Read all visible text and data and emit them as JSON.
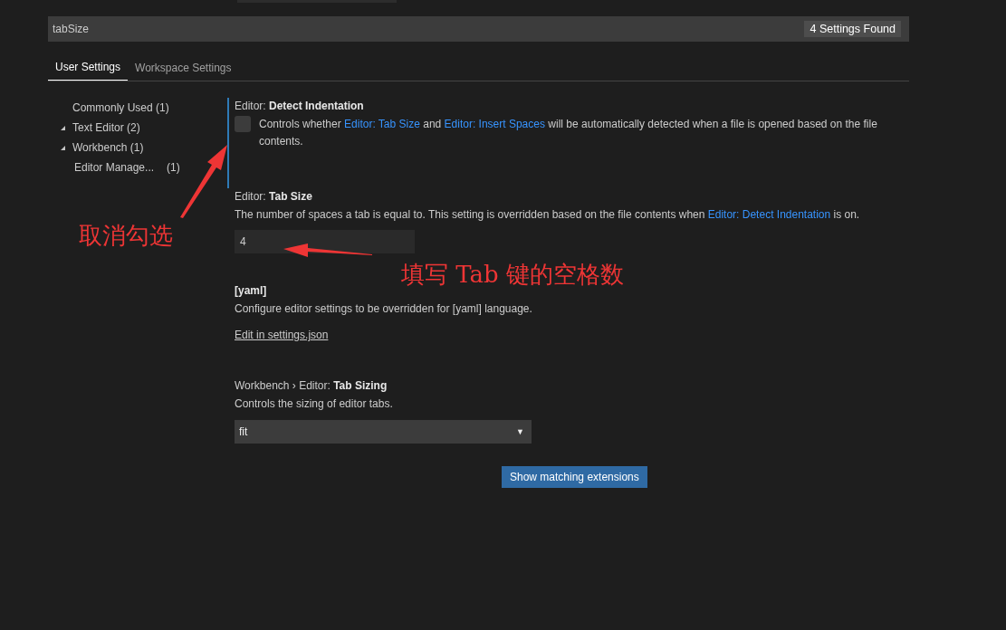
{
  "search": {
    "value": "tabSize",
    "count": "4 Settings Found"
  },
  "tabs": [
    {
      "label": "User Settings",
      "selected": true
    },
    {
      "label": "Workspace Settings",
      "selected": false
    }
  ],
  "sidebar": {
    "items": [
      {
        "kind": "leaf",
        "label": "Commonly Used",
        "count": "(1)"
      },
      {
        "kind": "group",
        "label": "Text Editor",
        "count": "(2)",
        "expanded": true
      },
      {
        "kind": "group",
        "label": "Workbench",
        "count": "(1)",
        "expanded": true,
        "children": [
          {
            "label": "Editor Manage...",
            "count": "(1)"
          }
        ]
      }
    ]
  },
  "settings": [
    {
      "kind": "checkbox",
      "focused": true,
      "prefix": "Editor:",
      "name": "Detect Indentation",
      "checked": false,
      "description": [
        {
          "kind": "text",
          "text": "Controls whether "
        },
        {
          "kind": "link",
          "text": "Editor: Tab Size"
        },
        {
          "kind": "text",
          "text": " and "
        },
        {
          "kind": "link",
          "text": "Editor: Insert Spaces"
        },
        {
          "kind": "text",
          "text": " will be automatically detected when a file is opened based on the file contents."
        }
      ]
    },
    {
      "kind": "number",
      "focused": false,
      "prefix": "Editor:",
      "name": "Tab Size",
      "value": "4",
      "description": [
        {
          "kind": "text",
          "text": "The number of spaces a tab is equal to. This setting is overridden based on the file contents when "
        },
        {
          "kind": "link",
          "text": "Editor: Detect Indentation"
        },
        {
          "kind": "text",
          "text": " is on."
        }
      ]
    },
    {
      "kind": "language",
      "focused": false,
      "name": "[yaml]",
      "link": "Edit in settings.json",
      "description": [
        {
          "kind": "text",
          "text": "Configure editor settings to be overridden for [yaml] language."
        }
      ]
    },
    {
      "kind": "select",
      "focused": false,
      "prefix": "Workbench › Editor:",
      "name": "Tab Sizing",
      "value": "fit",
      "caret": "▼",
      "description": [
        {
          "kind": "text",
          "text": "Controls the sizing of editor tabs."
        }
      ]
    }
  ],
  "button": "Show matching extensions",
  "annotations": [
    {
      "text": "取消勾选"
    },
    {
      "text": "填写 Tab 键的空格数"
    }
  ]
}
